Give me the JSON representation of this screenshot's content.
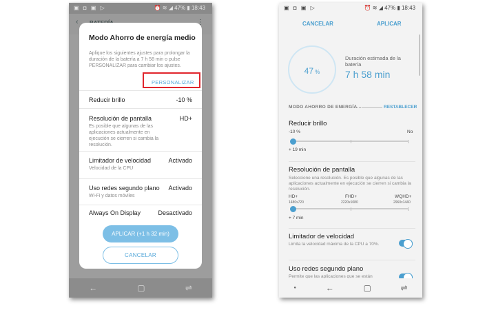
{
  "status_bar": {
    "time": "18:43",
    "battery": "47%"
  },
  "left": {
    "bg_title": "BATERÍA",
    "dialog": {
      "title": "Modo Ahorro de energía medio",
      "description": "Aplique los siguientes ajustes para prolongar la duración de la batería a 7 h 58 min o pulse PERSONALIZAR para cambiar los ajustes.",
      "personalize": "PERSONALIZAR",
      "rows": [
        {
          "label": "Reducir brillo",
          "value": "-10 %",
          "sub": ""
        },
        {
          "label": "Resolución de pantalla",
          "value": "HD+",
          "sub": "Es posible que algunas de las aplicaciones actualmente en ejecución se cierren si cambia la resolución."
        },
        {
          "label": "Limitador de velocidad",
          "value": "Activado",
          "sub": "Velocidad de la CPU"
        },
        {
          "label": "Uso redes segundo plano",
          "value": "Activado",
          "sub": "Wi-Fi y datos móviles"
        },
        {
          "label": "Always On Display",
          "value": "Desactivado",
          "sub": ""
        }
      ],
      "apply": "APLICAR (+1 h 32 min)",
      "cancel": "CANCELAR"
    }
  },
  "right": {
    "cancel": "CANCELAR",
    "apply": "APLICAR",
    "gauge_percent": "47",
    "gauge_unit": "%",
    "gauge_level": 0.47,
    "duration_label": "Duración estimada de la batería",
    "duration_value": "7 h 58 min",
    "section_header": "MODO AHORRO DE ENERGÍA...",
    "reset": "RESTABLECER",
    "brightness": {
      "title": "Reducir brillo",
      "min": "-10 %",
      "max": "No",
      "gain": "+ 19 min",
      "level": 0
    },
    "resolution": {
      "title": "Resolución de pantalla",
      "sub": "Seleccione una resolución. Es posible que algunas de las aplicaciones actualmente en ejecución se cierren si cambia la resolución.",
      "opt1": "HD+",
      "opt1_res": "1480x720",
      "opt2": "FHD+",
      "opt2_res": "2220x1080",
      "opt3": "WQHD+",
      "opt3_res": "2960x1440",
      "gain": "+ 7 min",
      "level": 0
    },
    "speed_limiter": {
      "title": "Limitador de velocidad",
      "sub": "Limita la velocidad máxima de la CPU a 70%."
    },
    "bg_data": {
      "title": "Uso redes segundo plano",
      "sub": "Permite que las aplicaciones que se están"
    }
  }
}
